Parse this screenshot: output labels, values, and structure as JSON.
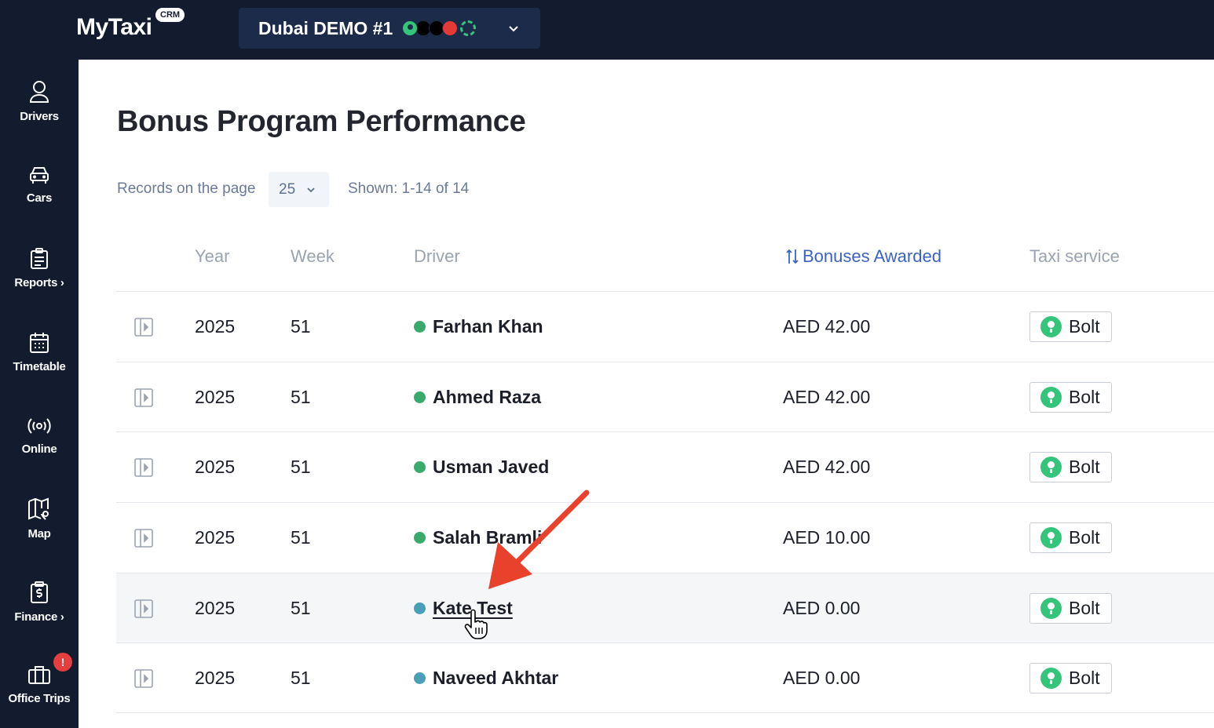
{
  "app": {
    "logo": "MyTaxi",
    "logo_badge": "CRM"
  },
  "fleet": {
    "name": "Dubai DEMO #1",
    "services": [
      "bolt-icon",
      "uber-icon",
      "mytaxi-icon",
      "yango-icon",
      "careem-icon"
    ]
  },
  "sidebar": {
    "items": [
      {
        "label": "Drivers",
        "icon": "user-icon"
      },
      {
        "label": "Cars",
        "icon": "car-icon"
      },
      {
        "label": "Reports",
        "icon": "clipboard-icon",
        "has_submenu": true
      },
      {
        "label": "Timetable",
        "icon": "calendar-icon"
      },
      {
        "label": "Online",
        "icon": "broadcast-icon"
      },
      {
        "label": "Map",
        "icon": "map-icon"
      },
      {
        "label": "Finance",
        "icon": "receipt-icon",
        "has_submenu": true
      },
      {
        "label": "Office Trips",
        "icon": "briefcase-icon",
        "badge": "!"
      }
    ]
  },
  "page": {
    "title": "Bonus Program Performance",
    "records_label": "Records on the page",
    "per_page": "25",
    "shown": "Shown: 1-14 of 14"
  },
  "table": {
    "columns": [
      "Year",
      "Week",
      "Driver",
      "Bonuses Awarded",
      "Taxi service"
    ],
    "sorted_column": "Bonuses Awarded",
    "rows": [
      {
        "year": "2025",
        "week": "51",
        "driver": "Farhan Khan",
        "status": "green",
        "bonus": "AED 42.00",
        "service": "Bolt"
      },
      {
        "year": "2025",
        "week": "51",
        "driver": "Ahmed Raza",
        "status": "green",
        "bonus": "AED 42.00",
        "service": "Bolt"
      },
      {
        "year": "2025",
        "week": "51",
        "driver": "Usman Javed",
        "status": "green",
        "bonus": "AED 42.00",
        "service": "Bolt"
      },
      {
        "year": "2025",
        "week": "51",
        "driver": "Salah Bramli",
        "status": "green",
        "bonus": "AED 10.00",
        "service": "Bolt"
      },
      {
        "year": "2025",
        "week": "51",
        "driver": "Kate Test",
        "status": "teal",
        "bonus": "AED 0.00",
        "service": "Bolt"
      },
      {
        "year": "2025",
        "week": "51",
        "driver": "Naveed Akhtar",
        "status": "teal",
        "bonus": "AED 0.00",
        "service": "Bolt"
      }
    ]
  },
  "colors": {
    "sidebar": "#131b2e",
    "accent": "#3a63c4",
    "annotation_arrow": "#e8412c"
  }
}
